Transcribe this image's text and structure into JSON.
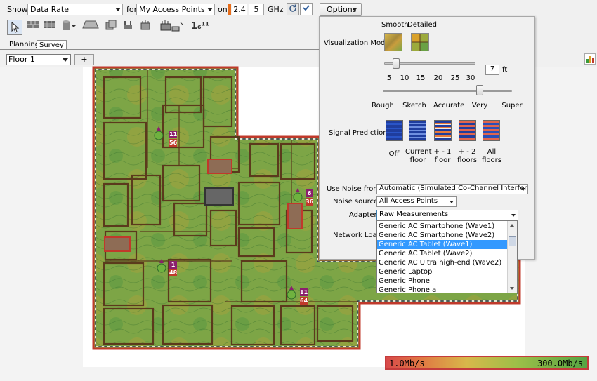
{
  "toolbar": {
    "show_label": "Show",
    "show_value": "Data Rate",
    "for_label": "for",
    "for_value": "My Access Points",
    "on_label": "on",
    "band1": "2.4",
    "band2": "5",
    "ghz_label": "GHz",
    "options_label": "Options"
  },
  "tabs": {
    "planning": "Planning",
    "survey": "Survey"
  },
  "floor": {
    "value": "Floor 1",
    "add_label": "+"
  },
  "tool_text": "1₆¹¹",
  "options": {
    "smooth": "Smooth",
    "detailed": "Detailed",
    "visualization_mode": "Visualization Mode:",
    "grid_value": "7",
    "grid_unit": "ft",
    "grid_ticks": [
      "5",
      "10",
      "15",
      "20",
      "25",
      "30"
    ],
    "grid_slider_level": 7,
    "quality_ticks": [
      "Rough",
      "Sketch",
      "Accurate",
      "Very",
      "Super"
    ],
    "quality_selected": "Very",
    "signal_prediction": "Signal Prediction:",
    "prediction_options": [
      "Off",
      "Current floor",
      "+ - 1 floor",
      "+ - 2 floors",
      "All floors"
    ],
    "use_noise_from_label": "Use Noise from:",
    "use_noise_from_value": "Automatic (Simulated Co-Channel Interference)",
    "noise_sources_label": "Noise sources:",
    "noise_sources_value": "All Access Points",
    "adapter_label": "Adapter:",
    "adapter_value": "Raw Measurements",
    "network_load_label": "Network Load:"
  },
  "adapter_options": [
    "Generic AC Smartphone (Wave1)",
    "Generic AC Smartphone (Wave2)",
    "Generic AC Tablet (Wave1)",
    "Generic AC Tablet (Wave2)",
    "Generic AC Ultra high-end (Wave2)",
    "Generic Laptop",
    "Generic Phone",
    "Generic Phone a"
  ],
  "adapter_selected_index": 2,
  "access_points": [
    {
      "top": "11",
      "bottom": "56"
    },
    {
      "top": "6",
      "bottom": "36"
    },
    {
      "top": "1",
      "bottom": "48"
    },
    {
      "top": "11",
      "bottom": "64"
    }
  ],
  "legend": {
    "min": "1.0Mb/s",
    "max": "300.0Mb/s"
  },
  "colors": {
    "accent_selection": "#3399ff",
    "heatmap_green": "#5aa04a",
    "heatmap_yellow": "#9ca23a",
    "wall_brown": "#5b3a1c",
    "outline_red": "#c0392b",
    "ap_badge": "#8b1f6d",
    "ap_badge2": "#c0392b"
  }
}
